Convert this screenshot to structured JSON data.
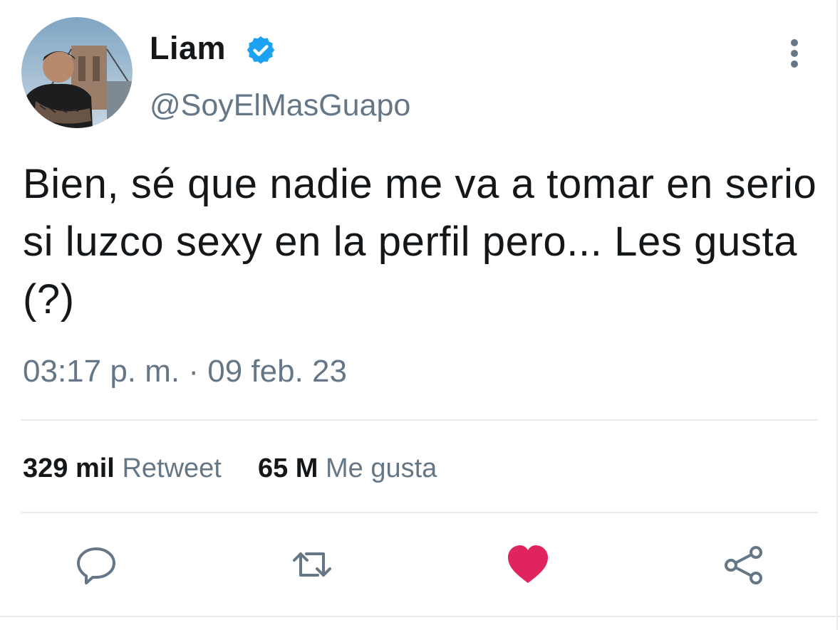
{
  "tweet": {
    "author": {
      "display_name": "Liam",
      "handle": "@SoyElMasGuapo",
      "verified": true,
      "verified_icon": "verified-badge-icon"
    },
    "text": "Bien, sé que nadie me va a tomar en serio si luzco sexy en la perfil pero... Les gusta (?)",
    "timestamp": "03:17 p. m. · 09 feb. 23",
    "stats": {
      "retweets_count": "329 mil",
      "retweets_label": "Retweet",
      "likes_count": "65 M",
      "likes_label": "Me gusta"
    },
    "actions": [
      {
        "name": "reply",
        "icon": "comment-icon"
      },
      {
        "name": "retweet",
        "icon": "retweet-icon"
      },
      {
        "name": "like",
        "icon": "heart-icon",
        "active": true
      },
      {
        "name": "share",
        "icon": "share-icon"
      }
    ]
  },
  "colors": {
    "verified_blue": "#1da1f2",
    "secondary_text": "#657786",
    "like_active": "#e0245e",
    "divider": "#e6ecf0"
  }
}
